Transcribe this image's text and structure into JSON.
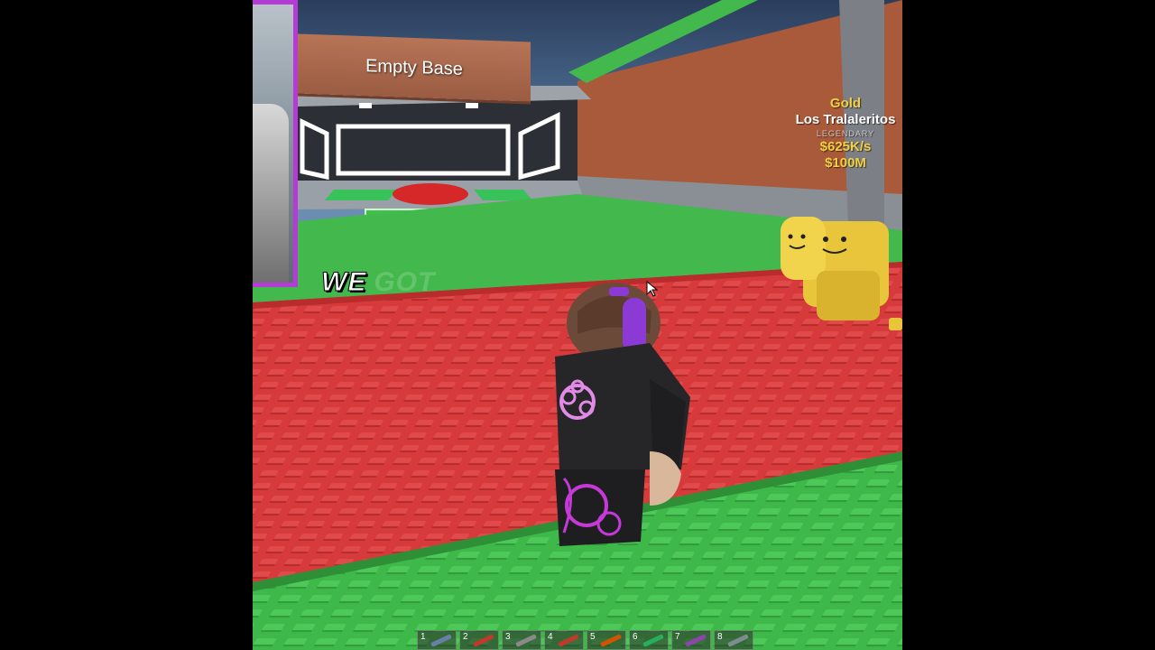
{
  "base_sign": {
    "label": "Empty Base"
  },
  "pet_tag": {
    "rarity": "Gold",
    "name": "Los Tralaleritos",
    "tier": "LEGENDARY",
    "income": "$625K/s",
    "price": "$100M"
  },
  "caption": {
    "word1": "WE",
    "word2": "GOT"
  },
  "hotbar": {
    "slots": [
      {
        "num": "1",
        "tool_color": "#6a7fa8"
      },
      {
        "num": "2",
        "tool_color": "#c0392b"
      },
      {
        "num": "3",
        "tool_color": "#8a8a8a"
      },
      {
        "num": "4",
        "tool_color": "#c0392b"
      },
      {
        "num": "5",
        "tool_color": "#d35400"
      },
      {
        "num": "6",
        "tool_color": "#27ae60"
      },
      {
        "num": "7",
        "tool_color": "#8e44ad"
      },
      {
        "num": "8",
        "tool_color": "#7f8c8d"
      }
    ]
  },
  "colors": {
    "accent_purple": "#b53bd6",
    "money_gold": "#f4d03f",
    "ground_red": "#d63a3a",
    "grass_green": "#3fb84a"
  }
}
